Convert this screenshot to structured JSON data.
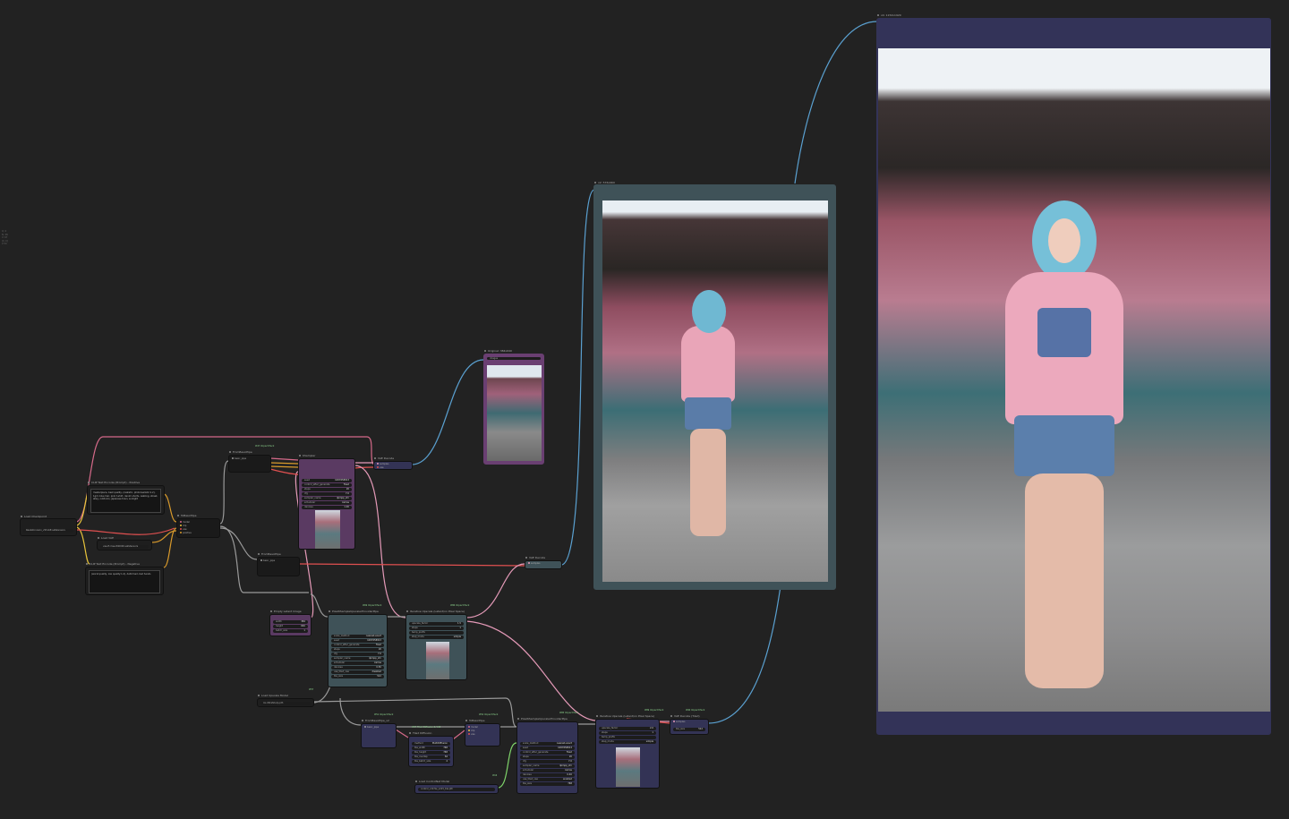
{
  "palette": {
    "canvas_bg": "#222222",
    "node_bg": "#353535",
    "wire_pink": "#d66a8a",
    "wire_orange": "#d99a2b",
    "wire_yellow": "#e6c23b",
    "wire_blue": "#5aa0d0",
    "wire_purple": "#b57ad6",
    "wire_green": "#7fd46a",
    "wire_gray": "#9a9a9a"
  },
  "sidebar": {
    "lines": [
      "Q: 0",
      "N: 38",
      "V: 67",
      "[0, 0]",
      "2.50"
    ]
  },
  "nodes": {
    "checkpoint": {
      "title": "Load Checkpoint",
      "widget": "ckpt_name",
      "value": "Realisticvision_v51VAE.safetensors"
    },
    "clip_pos": {
      "title": "CLIP Text Encode (Prompt) - Positive",
      "text": "masterpiece, best quality, (realistic, photorealistic:1.2), 1girl, blue hair, pink t-shirt, denim shorts, walking, street, alley, outdoors, japanese town, sunlight"
    },
    "clip_neg": {
      "title": "CLIP Text Encode (Prompt) - Negative",
      "text": "(worst quality, low quality:1.4), deformed, bad hands"
    },
    "load_vae": {
      "title": "Load VAE",
      "value": "vae-ft-mse-840000.safetensors"
    },
    "to_basic_pipe": {
      "title": "ToBasicPipe",
      "tag": "#47 Impact Pack"
    },
    "from_basic_pipe_1": {
      "title": "FromBasicPipe",
      "tag": "#47 Impact Pack"
    },
    "from_basic_pipe_2": {
      "title": "FromBasicPipe",
      "tag": "#47 Impact Pack"
    },
    "ksampler": {
      "title": "KSampler",
      "rows": [
        [
          "seed",
          "1087658813"
        ],
        [
          "control_after_generate",
          "fixed"
        ],
        [
          "steps",
          "20"
        ],
        [
          "cfg",
          "7.0"
        ],
        [
          "sampler_name",
          "dpmpp_2m"
        ],
        [
          "scheduler",
          "karras"
        ],
        [
          "denoise",
          "1.00"
        ]
      ]
    },
    "vae_decode_1": {
      "title": "VAE Decode"
    },
    "vae_decode_2": {
      "title": "VAE Decode"
    },
    "vae_decode_tiled": {
      "title": "VAE Decode (Tiled)",
      "tag": "#90 Impact Pack"
    },
    "preview_original": {
      "title": "Original: 384x640",
      "tag": "#15"
    },
    "preview_mid": {
      "title": "x2: 576x960",
      "tag": "#20"
    },
    "preview_final": {
      "title": "x4: 1152x1920",
      "tag": "#30"
    },
    "empty_latent": {
      "title": "Empty Latent Image",
      "rows": [
        [
          "width",
          "384"
        ],
        [
          "height",
          "640"
        ],
        [
          "batch_size",
          "1"
        ]
      ]
    },
    "upscaler_provider_1": {
      "title": "PixelKSampleUpscalerProviderPipe",
      "tag": "#69 Impact Pack",
      "rows": [
        [
          "scale_method",
          "nearest-exact"
        ],
        [
          "seed",
          "1087658813"
        ],
        [
          "control_after_generate",
          "fixed"
        ],
        [
          "steps",
          "20"
        ],
        [
          "cfg",
          "7.0"
        ],
        [
          "sampler_name",
          "dpmpp_2m"
        ],
        [
          "scheduler",
          "karras"
        ],
        [
          "denoise",
          "0.50"
        ],
        [
          "use_tiled_vae",
          "disabled"
        ],
        [
          "tile_size",
          "512"
        ]
      ]
    },
    "iterative_upscale_1": {
      "title": "Iterative Upscale (Latent/on Pixel Space)",
      "tag": "#86 Impact Pack",
      "rows": [
        [
          "upscale_factor",
          "1.5"
        ],
        [
          "steps",
          "1"
        ],
        [
          "temp_prefix",
          ""
        ],
        [
          "step_mode",
          "simple"
        ]
      ]
    },
    "load_upscale_model": {
      "title": "Load Upscale Model",
      "value": "4x-UltraSharp.pth",
      "tag": "#57"
    },
    "from_basic_pipe_3": {
      "title": "FromBasicPipe_v2",
      "tag": "#51 Impact Pack"
    },
    "tile_diffusion": {
      "title": "Tiled Diffusion",
      "tag": "#57 Tiled Diffusion & VAE",
      "rows": [
        [
          "method",
          "MultiDiffusion"
        ],
        [
          "tile_width",
          "768"
        ],
        [
          "tile_height",
          "768"
        ],
        [
          "tile_overlap",
          "64"
        ],
        [
          "tile_batch_size",
          "4"
        ]
      ]
    },
    "to_basic_pipe_2": {
      "title": "ToBasicPipe",
      "tag": "#52 Impact Pack"
    },
    "upscaler_provider_2": {
      "title": "PixelKSampleUpscalerProviderPipe",
      "tag": "#85 Impact Pack",
      "rows": [
        [
          "scale_method",
          "nearest-exact"
        ],
        [
          "seed",
          "1087658813"
        ],
        [
          "control_after_generate",
          "fixed"
        ],
        [
          "steps",
          "20"
        ],
        [
          "cfg",
          "7.0"
        ],
        [
          "sampler_name",
          "dpmpp_2m"
        ],
        [
          "scheduler",
          "karras"
        ],
        [
          "denoise",
          "0.40"
        ],
        [
          "use_tiled_vae",
          "enabled"
        ],
        [
          "tile_size",
          "768"
        ]
      ]
    },
    "iterative_upscale_2": {
      "title": "Iterative Upscale (Latent/on Pixel Space)",
      "tag": "#89 Impact Pack",
      "rows": [
        [
          "upscale_factor",
          "2.0"
        ],
        [
          "steps",
          "1"
        ],
        [
          "temp_prefix",
          ""
        ],
        [
          "step_mode",
          "simple"
        ]
      ]
    },
    "load_controlnet": {
      "title": "Load ControlNet Model",
      "value": "control_v11f1e_sd15_tile.pth",
      "tag": "#16"
    }
  }
}
